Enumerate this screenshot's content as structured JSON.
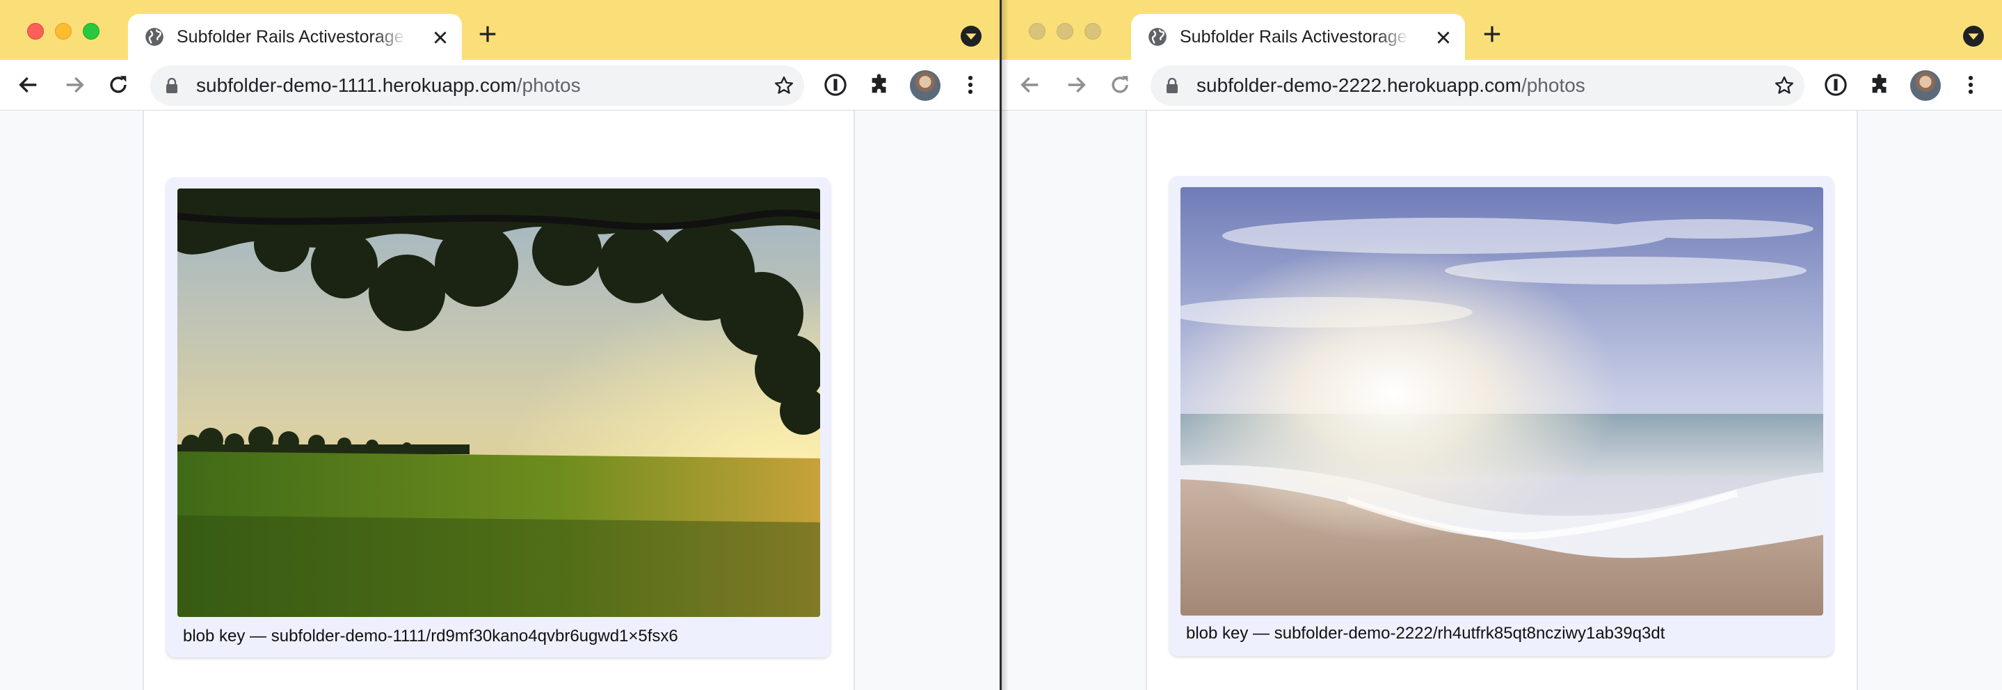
{
  "windows": [
    {
      "tab_title": "Subfolder Rails Activestorage Example",
      "url_host": "subfolder-demo-1111.herokuapp.com",
      "url_path": "/photos",
      "photo_alt": "Green field under tree at sunset",
      "caption": "blob key — subfolder-demo-1111/rd9mf30kano4qvbr6ugwd1×5fsx6"
    },
    {
      "tab_title": "Subfolder Rails Activestorage Example",
      "url_host": "subfolder-demo-2222.herokuapp.com",
      "url_path": "/photos",
      "photo_alt": "Sunlit beach with waves",
      "caption": "blob key — subfolder-demo-2222/rh4utfrk85qt8ncziwy1ab39q3dt"
    }
  ],
  "icons": {
    "globe": "globe-icon",
    "close": "close-icon",
    "plus": "plus-icon",
    "tab_search": "tab-search-icon",
    "back": "back-icon",
    "forward": "forward-icon",
    "reload": "reload-icon",
    "lock": "lock-icon",
    "star": "star-icon",
    "extension_info": "info-icon",
    "extensions": "puzzle-icon",
    "menu": "kebab-menu-icon"
  },
  "colors": {
    "titlebar": "#fadf78",
    "card": "#eef0fd",
    "link": "#38a89d"
  }
}
